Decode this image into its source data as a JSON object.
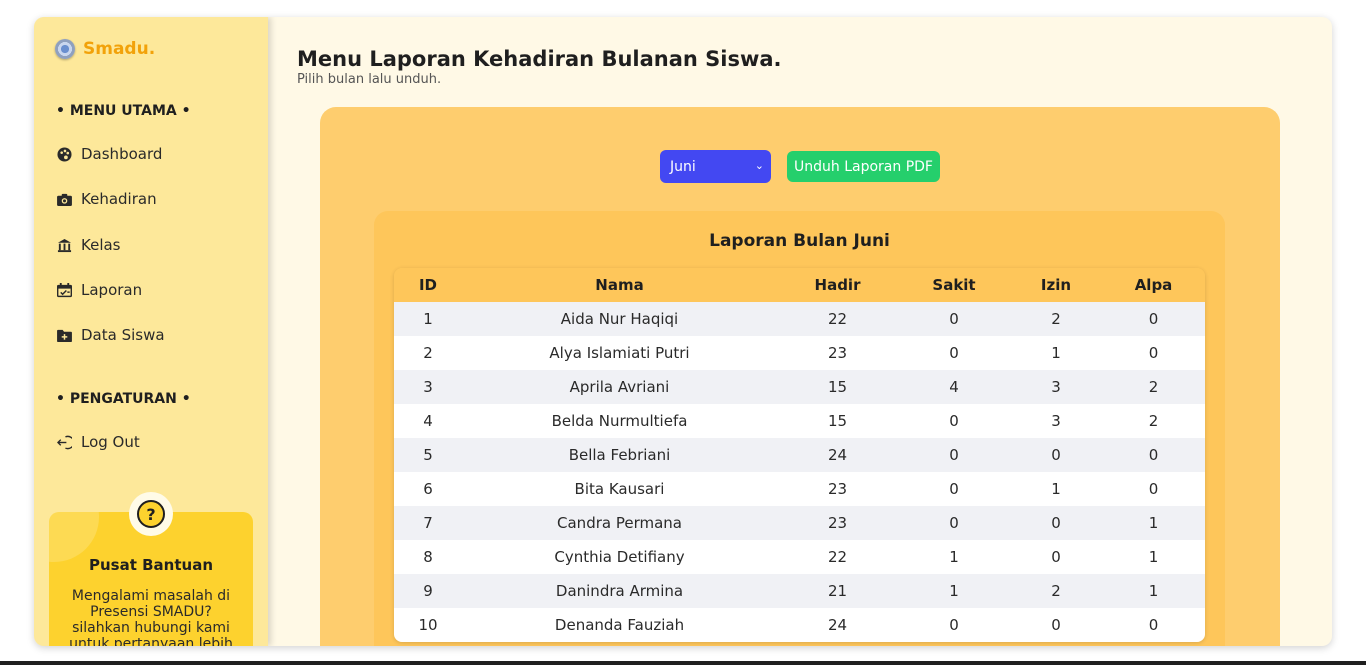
{
  "brand": {
    "name": "Smadu."
  },
  "sidebar": {
    "main_title": "• MENU UTAMA •",
    "items": [
      {
        "label": "Dashboard",
        "icon": "palette-icon"
      },
      {
        "label": "Kehadiran",
        "icon": "camera-icon"
      },
      {
        "label": "Kelas",
        "icon": "building-icon"
      },
      {
        "label": "Laporan",
        "icon": "calendar-check-icon"
      },
      {
        "label": "Data Siswa",
        "icon": "folder-plus-icon"
      }
    ],
    "settings_title": "• PENGATURAN •",
    "logout": {
      "label": "Log Out",
      "icon": "logout-icon"
    }
  },
  "help": {
    "icon": "question-icon",
    "title": "Pusat Bantuan",
    "text": "Mengalami masalah di Presensi SMADU? silahkan hubungi kami untuk pertanyaan lebih"
  },
  "header": {
    "title": "Menu Laporan Kehadiran Bulanan Siswa.",
    "subtitle": "Pilih bulan lalu unduh."
  },
  "controls": {
    "selected_month": "Juni",
    "download_label": "Unduh Laporan PDF"
  },
  "report": {
    "title": "Laporan Bulan Juni",
    "columns": [
      "ID",
      "Nama",
      "Hadir",
      "Sakit",
      "Izin",
      "Alpa"
    ],
    "rows": [
      [
        "1",
        "Aida Nur Haqiqi",
        "22",
        "0",
        "2",
        "0"
      ],
      [
        "2",
        "Alya Islamiati Putri",
        "23",
        "0",
        "1",
        "0"
      ],
      [
        "3",
        "Aprila Avriani",
        "15",
        "4",
        "3",
        "2"
      ],
      [
        "4",
        "Belda Nurmultiefa",
        "15",
        "0",
        "3",
        "2"
      ],
      [
        "5",
        "Bella Febriani",
        "24",
        "0",
        "0",
        "0"
      ],
      [
        "6",
        "Bita Kausari",
        "23",
        "0",
        "1",
        "0"
      ],
      [
        "7",
        "Candra Permana",
        "23",
        "0",
        "0",
        "1"
      ],
      [
        "8",
        "Cynthia Detifiany",
        "22",
        "1",
        "0",
        "1"
      ],
      [
        "9",
        "Danindra Armina",
        "21",
        "1",
        "2",
        "1"
      ],
      [
        "10",
        "Denanda Fauziah",
        "24",
        "0",
        "0",
        "0"
      ]
    ]
  },
  "colors": {
    "sidebar_bg": "#fde89a",
    "brand": "#f2a20a",
    "select_bg": "#4348f2",
    "download_bg": "#25cf6c",
    "panel_bg": "#fecd6e",
    "card_bg": "#fec65a"
  }
}
